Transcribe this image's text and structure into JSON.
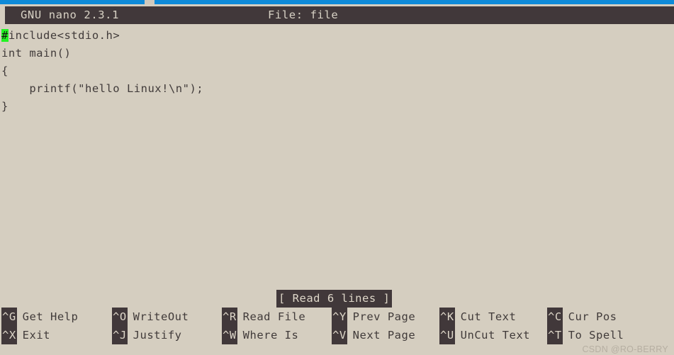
{
  "window": {
    "os_strip_color": "#0e8ad8",
    "background_color": "#d5cec0",
    "bar_color": "#41383a",
    "text_color": "#413b3a",
    "bar_text_color": "#ded7c9",
    "cursor_color": "#22f322"
  },
  "titlebar": {
    "app": "GNU nano 2.3.1",
    "file": "File: file"
  },
  "editor": {
    "cursor_char": "#",
    "lines": [
      {
        "prefix": "",
        "rest": "include<stdio.h>",
        "has_cursor": true
      },
      {
        "prefix": "",
        "rest": "int main()",
        "has_cursor": false
      },
      {
        "prefix": "",
        "rest": "{",
        "has_cursor": false
      },
      {
        "prefix": "",
        "rest": "    printf(\"hello Linux!\\n\");",
        "has_cursor": false
      },
      {
        "prefix": "",
        "rest": "}",
        "has_cursor": false
      }
    ]
  },
  "status": {
    "message": "[ Read 6 lines ]"
  },
  "shortcuts": {
    "row1": [
      {
        "key": "^G",
        "label": "Get Help"
      },
      {
        "key": "^O",
        "label": "WriteOut"
      },
      {
        "key": "^R",
        "label": "Read File"
      },
      {
        "key": "^Y",
        "label": "Prev Page"
      },
      {
        "key": "^K",
        "label": "Cut Text"
      },
      {
        "key": "^C",
        "label": "Cur Pos"
      }
    ],
    "row2": [
      {
        "key": "^X",
        "label": "Exit"
      },
      {
        "key": "^J",
        "label": "Justify"
      },
      {
        "key": "^W",
        "label": "Where Is"
      },
      {
        "key": "^V",
        "label": "Next Page"
      },
      {
        "key": "^U",
        "label": "UnCut Text"
      },
      {
        "key": "^T",
        "label": "To Spell"
      }
    ]
  },
  "watermark": {
    "text": "CSDN @RO-BERRY"
  }
}
